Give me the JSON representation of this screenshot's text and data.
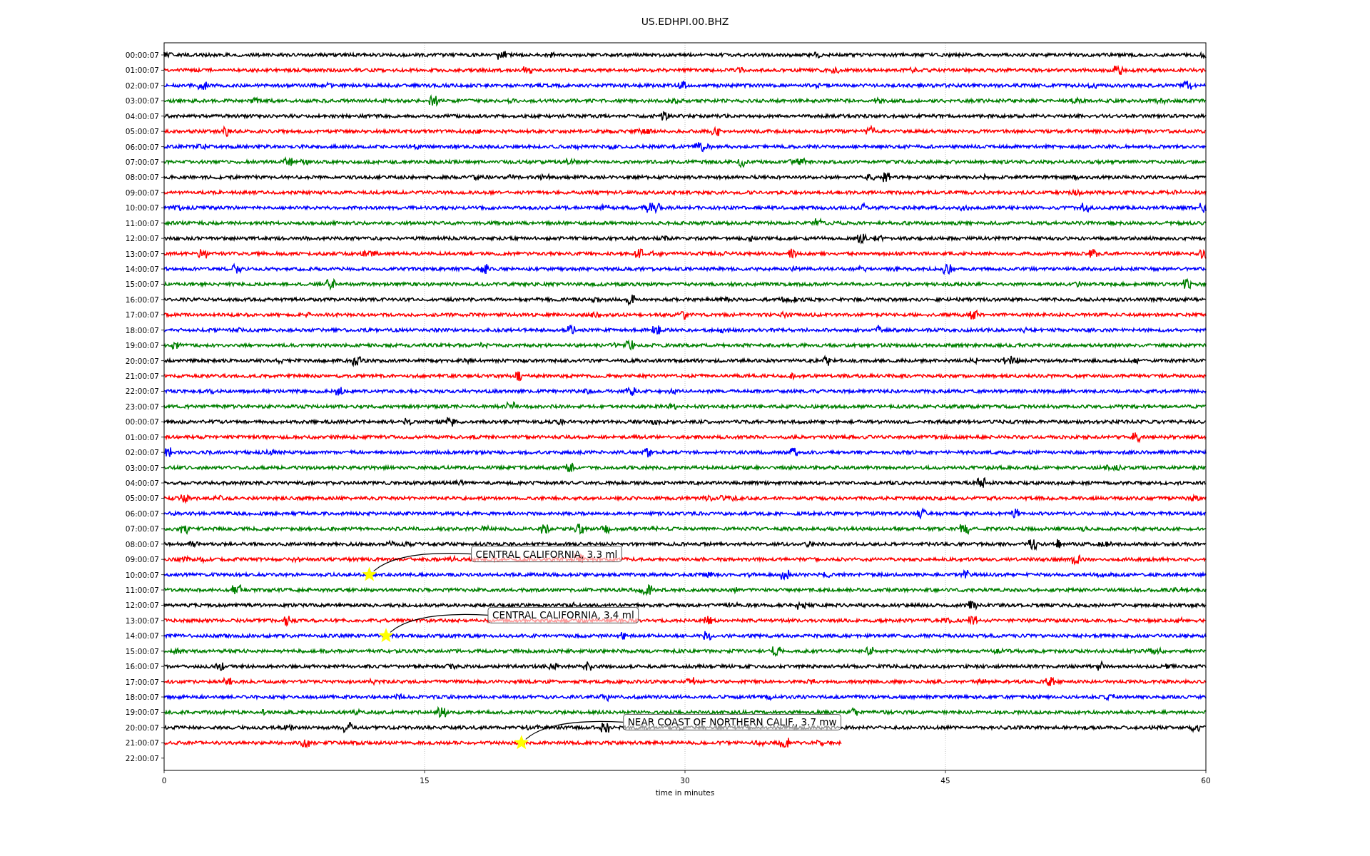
{
  "plot": {
    "title": "US.EDHPI.00.BHZ",
    "xlabel": "time in minutes",
    "xticks": [
      "0",
      "15",
      "30",
      "45",
      "60"
    ],
    "rows": [
      {
        "label": "00:00:07",
        "color": "#000000"
      },
      {
        "label": "01:00:07",
        "color": "#ff0000"
      },
      {
        "label": "02:00:07",
        "color": "#0000ff"
      },
      {
        "label": "03:00:07",
        "color": "#008000"
      },
      {
        "label": "04:00:07",
        "color": "#000000"
      },
      {
        "label": "05:00:07",
        "color": "#ff0000"
      },
      {
        "label": "06:00:07",
        "color": "#0000ff"
      },
      {
        "label": "07:00:07",
        "color": "#008000"
      },
      {
        "label": "08:00:07",
        "color": "#000000"
      },
      {
        "label": "09:00:07",
        "color": "#ff0000"
      },
      {
        "label": "10:00:07",
        "color": "#0000ff"
      },
      {
        "label": "11:00:07",
        "color": "#008000"
      },
      {
        "label": "12:00:07",
        "color": "#000000"
      },
      {
        "label": "13:00:07",
        "color": "#ff0000"
      },
      {
        "label": "14:00:07",
        "color": "#0000ff"
      },
      {
        "label": "15:00:07",
        "color": "#008000"
      },
      {
        "label": "16:00:07",
        "color": "#000000"
      },
      {
        "label": "17:00:07",
        "color": "#ff0000"
      },
      {
        "label": "18:00:07",
        "color": "#0000ff"
      },
      {
        "label": "19:00:07",
        "color": "#008000"
      },
      {
        "label": "20:00:07",
        "color": "#000000"
      },
      {
        "label": "21:00:07",
        "color": "#ff0000"
      },
      {
        "label": "22:00:07",
        "color": "#0000ff"
      },
      {
        "label": "23:00:07",
        "color": "#008000"
      },
      {
        "label": "00:00:07",
        "color": "#000000"
      },
      {
        "label": "01:00:07",
        "color": "#ff0000"
      },
      {
        "label": "02:00:07",
        "color": "#0000ff"
      },
      {
        "label": "03:00:07",
        "color": "#008000"
      },
      {
        "label": "04:00:07",
        "color": "#000000"
      },
      {
        "label": "05:00:07",
        "color": "#ff0000"
      },
      {
        "label": "06:00:07",
        "color": "#0000ff"
      },
      {
        "label": "07:00:07",
        "color": "#008000"
      },
      {
        "label": "08:00:07",
        "color": "#000000"
      },
      {
        "label": "09:00:07",
        "color": "#ff0000"
      },
      {
        "label": "10:00:07",
        "color": "#0000ff",
        "event": {
          "label": "CENTRAL CALIFORNIA, 3.3 ml",
          "level": 0.197
        }
      },
      {
        "label": "11:00:07",
        "color": "#008000"
      },
      {
        "label": "12:00:07",
        "color": "#000000"
      },
      {
        "label": "13:00:07",
        "color": "#ff0000"
      },
      {
        "label": "14:00:07",
        "color": "#0000ff",
        "event": {
          "label": "CENTRAL CALIFORNIA, 3.4 ml",
          "level": 0.213
        }
      },
      {
        "label": "15:00:07",
        "color": "#008000"
      },
      {
        "label": "16:00:07",
        "color": "#000000"
      },
      {
        "label": "17:00:07",
        "color": "#ff0000"
      },
      {
        "label": "18:00:07",
        "color": "#0000ff"
      },
      {
        "label": "19:00:07",
        "color": "#008000"
      },
      {
        "label": "20:00:07",
        "color": "#000000"
      },
      {
        "label": "21:00:07",
        "color": "#ff0000",
        "level": 0.65,
        "event": {
          "label": "NEAR COAST OF NORTHERN CALIF., 3.7 mw",
          "level": 0.343
        }
      },
      {
        "label": "22:00:07"
      }
    ]
  }
}
